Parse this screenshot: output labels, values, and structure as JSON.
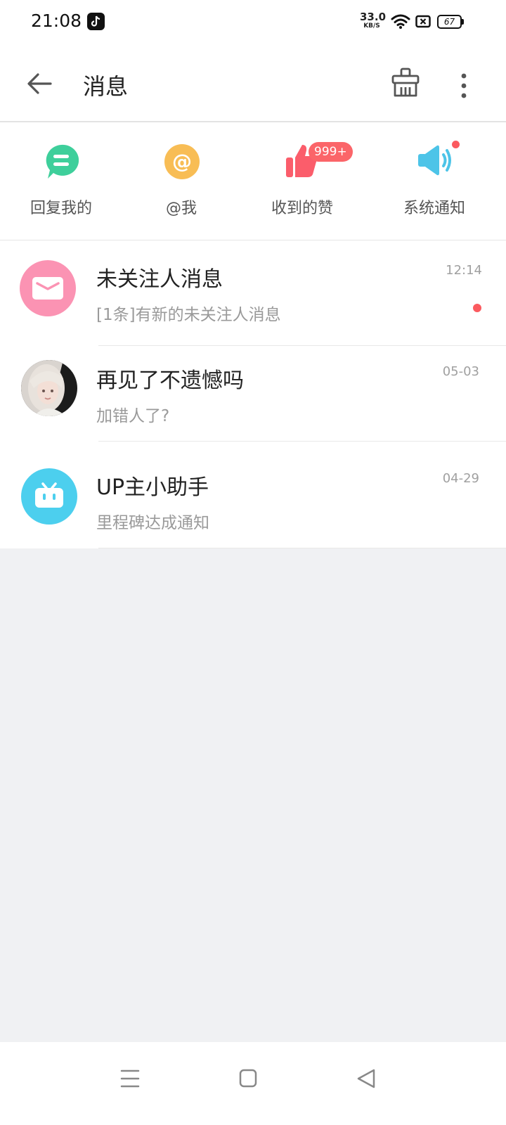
{
  "status_bar": {
    "time": "21:08",
    "net_speed_value": "33.0",
    "net_speed_unit": "KB/S",
    "battery": "67"
  },
  "header": {
    "title": "消息"
  },
  "categories": [
    {
      "label": "回复我的",
      "icon": "reply-bubble-icon",
      "color": "#3ecf9b"
    },
    {
      "label": "@我",
      "icon": "at-sign-icon",
      "color": "#f8bd55"
    },
    {
      "label": "收到的赞",
      "icon": "thumbs-up-icon",
      "color": "#fb5d6b",
      "badge": "999+"
    },
    {
      "label": "系统通知",
      "icon": "speaker-icon",
      "color": "#4dc4e8",
      "dot": true
    }
  ],
  "conversations": [
    {
      "name": "未关注人消息",
      "preview": "[1条]有新的未关注人消息",
      "time": "12:14",
      "avatar": "envelope-icon",
      "unread": true,
      "color": "#fb93b3"
    },
    {
      "name": "再见了不遗憾吗",
      "preview": "加错人了?",
      "time": "05-03",
      "avatar": "user-photo"
    },
    {
      "name": "UP主小助手",
      "preview": "里程碑达成通知",
      "time": "04-29",
      "avatar": "tv-robot-icon",
      "color": "#4ccfee"
    }
  ],
  "colors": {
    "accent_pink": "#fb5a5f",
    "background": "#f0f1f3"
  }
}
